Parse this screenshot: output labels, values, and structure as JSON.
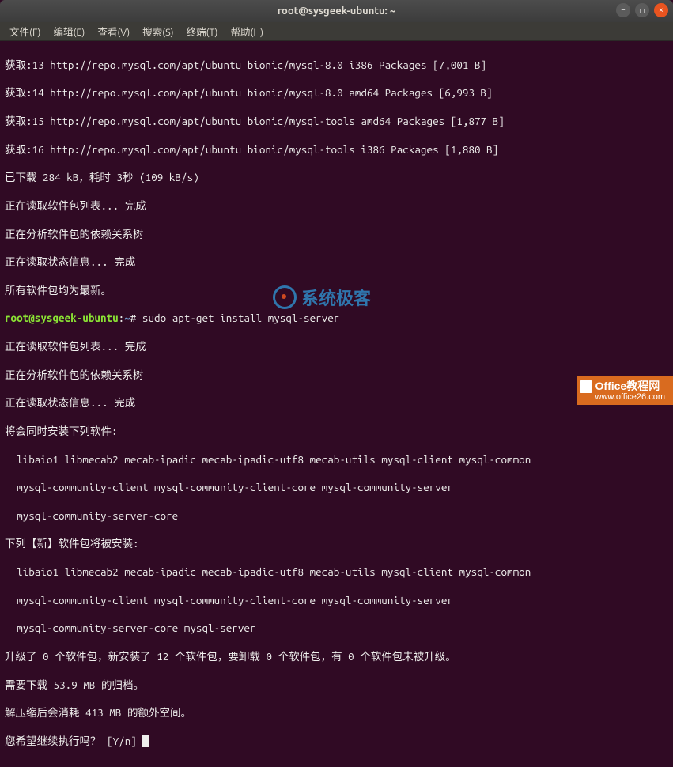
{
  "titlebar": {
    "title": "root@sysgeek-ubuntu: ~"
  },
  "menubar": {
    "file": "文件(F)",
    "edit": "编辑(E)",
    "view": "查看(V)",
    "search": "搜索(S)",
    "terminal": "终端(T)",
    "help": "帮助(H)"
  },
  "watermark": {
    "text": "系统极客"
  },
  "badge": {
    "top": "Office教程网",
    "bottom": "www.office26.com"
  },
  "term": {
    "l1": "获取:13 http://repo.mysql.com/apt/ubuntu bionic/mysql-8.0 i386 Packages [7,001 B]",
    "l2": "获取:14 http://repo.mysql.com/apt/ubuntu bionic/mysql-8.0 amd64 Packages [6,993 B]",
    "l3": "获取:15 http://repo.mysql.com/apt/ubuntu bionic/mysql-tools amd64 Packages [1,877 B]",
    "l4": "获取:16 http://repo.mysql.com/apt/ubuntu bionic/mysql-tools i386 Packages [1,880 B]",
    "l5": "已下载 284 kB，耗时 3秒 (109 kB/s)",
    "l6": "正在读取软件包列表... 完成",
    "l7": "正在分析软件包的依赖关系树",
    "l8": "正在读取状态信息... 完成",
    "l9": "所有软件包均为最新。",
    "prompt_user": "root@sysgeek-ubuntu",
    "prompt_sep": ":",
    "prompt_path": "~",
    "prompt_hash": "# ",
    "cmd": "sudo apt-get install mysql-server",
    "l11": "正在读取软件包列表... 完成",
    "l12": "正在分析软件包的依赖关系树",
    "l13": "正在读取状态信息... 完成",
    "l14": "将会同时安装下列软件:",
    "l15": "  libaio1 libmecab2 mecab-ipadic mecab-ipadic-utf8 mecab-utils mysql-client mysql-common",
    "l16": "  mysql-community-client mysql-community-client-core mysql-community-server",
    "l17": "  mysql-community-server-core",
    "l18": "下列【新】软件包将被安装:",
    "l19": "  libaio1 libmecab2 mecab-ipadic mecab-ipadic-utf8 mecab-utils mysql-client mysql-common",
    "l20": "  mysql-community-client mysql-community-client-core mysql-community-server",
    "l21": "  mysql-community-server-core mysql-server",
    "l22": "升级了 0 个软件包，新安装了 12 个软件包，要卸载 0 个软件包，有 0 个软件包未被升级。",
    "l23": "需要下载 53.9 MB 的归档。",
    "l24": "解压缩后会消耗 413 MB 的额外空间。",
    "l25": "您希望继续执行吗？ [Y/n] "
  }
}
